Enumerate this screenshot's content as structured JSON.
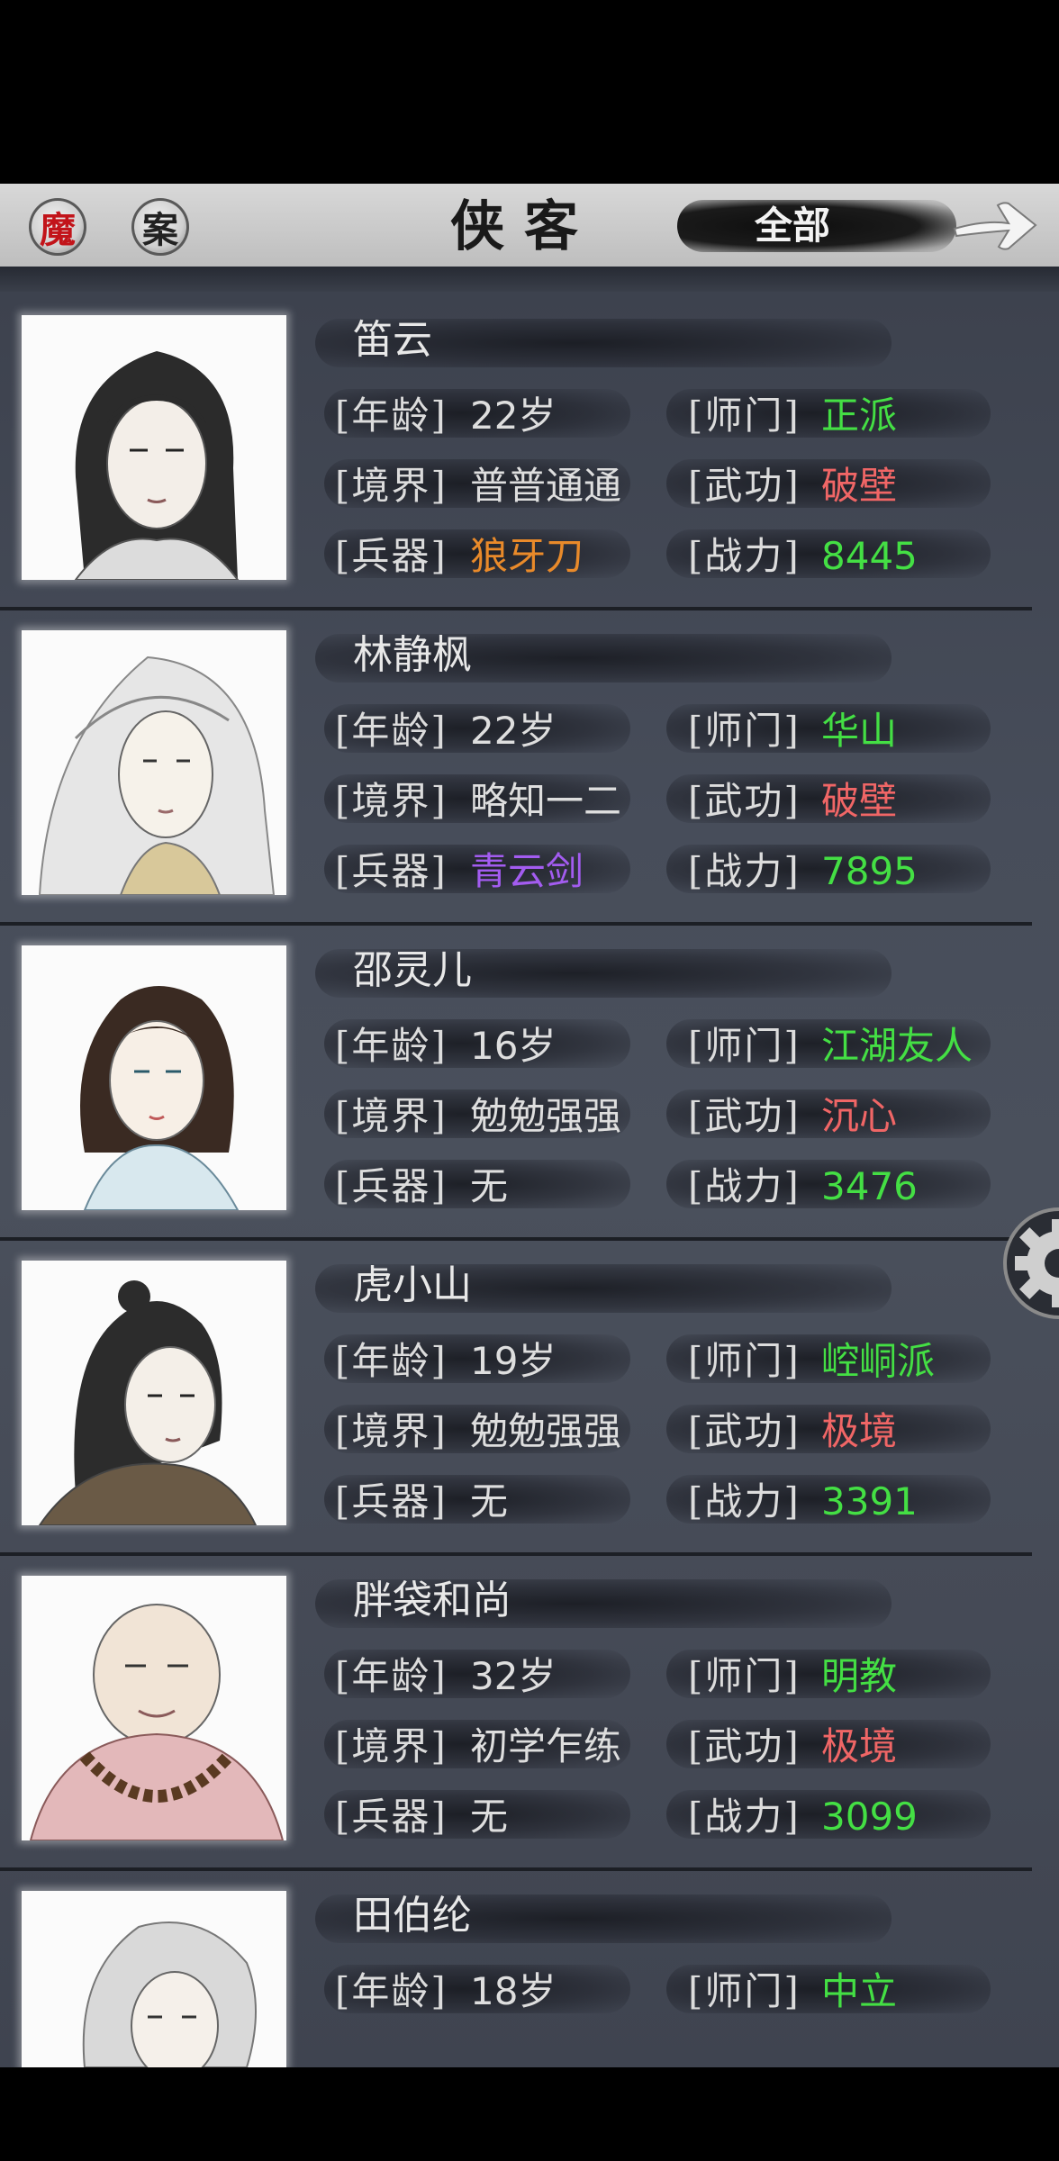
{
  "header": {
    "seal_left": "魔",
    "seal_right": "案",
    "title": "侠客",
    "filter_label": "全部",
    "next_icon": "arrow-right-icon"
  },
  "labels": {
    "age": "[年龄]",
    "realm": "[境界]",
    "weapon": "[兵器]",
    "sect": "[师门]",
    "skill": "[武功]",
    "power": "[战力]"
  },
  "colors": {
    "green": "#44df44",
    "red": "#f06666",
    "orange": "#e98a2a",
    "purple": "#a35cf0"
  },
  "heroes": [
    {
      "name": "笛云",
      "age": "22岁",
      "realm": "普普通通",
      "weapon": "狼牙刀",
      "weapon_color": "orange",
      "sect": "正派",
      "skill": "破壁",
      "power": "8445"
    },
    {
      "name": "林静枫",
      "age": "22岁",
      "realm": "略知一二",
      "weapon": "青云剑",
      "weapon_color": "purple",
      "sect": "华山",
      "skill": "破壁",
      "power": "7895"
    },
    {
      "name": "邵灵儿",
      "age": "16岁",
      "realm": "勉勉强强",
      "weapon": "无",
      "weapon_color": "white",
      "sect": "江湖友人",
      "skill": "沉心",
      "power": "3476"
    },
    {
      "name": "虎小山",
      "age": "19岁",
      "realm": "勉勉强强",
      "weapon": "无",
      "weapon_color": "white",
      "sect": "崆峒派",
      "skill": "极境",
      "power": "3391"
    },
    {
      "name": "胖袋和尚",
      "age": "32岁",
      "realm": "初学乍练",
      "weapon": "无",
      "weapon_color": "white",
      "sect": "明教",
      "skill": "极境",
      "power": "3099"
    },
    {
      "name": "田伯纶",
      "age": "18岁",
      "sect": "中立"
    }
  ]
}
